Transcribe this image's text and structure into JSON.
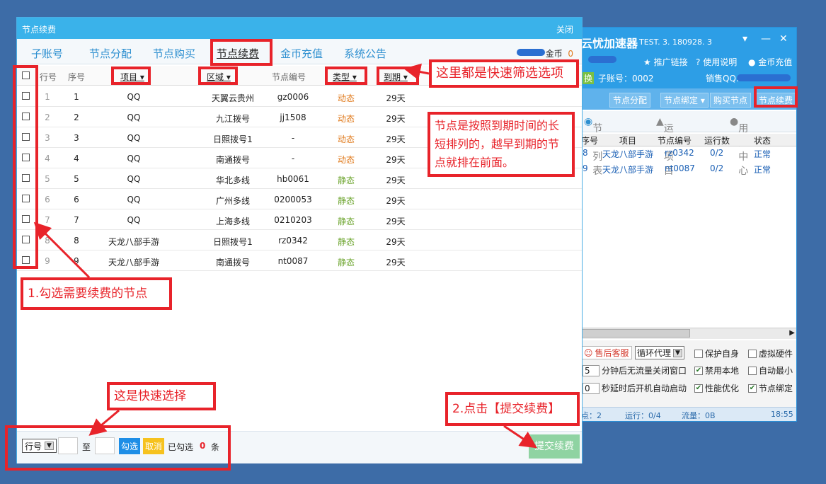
{
  "back_window": {
    "app_title": "云忧加速器",
    "version": "TEST. 3. 180928. 3",
    "promo_link": "推广链接",
    "help_link": "使用说明",
    "coin_recharge_link": "金币充值",
    "switch_label": "换",
    "sub_account_label": "子账号：0002",
    "sales_qq_label": "销售QQ:",
    "nav": [
      "节点分配",
      "节点绑定 ▾",
      "购买节点",
      "节点续费"
    ],
    "tabs": [
      "节点列表",
      "运行项目",
      "用户中心"
    ],
    "headers": [
      "序号",
      "项目",
      "节点编号",
      "运行数",
      "状态"
    ],
    "rows": [
      {
        "no": "8",
        "project": "天龙八部手游",
        "node": "rz0342",
        "runs": "0/2",
        "status": "正常"
      },
      {
        "no": "9",
        "project": "天龙八部手游",
        "node": "nt0087",
        "runs": "0/2",
        "status": "正常"
      }
    ],
    "service_button": "售后客服",
    "proxy_mode": "循环代理",
    "minutes_value": "5",
    "minutes_label": "分钟后无流量关闭窗口",
    "seconds_value": "0",
    "seconds_label": "秒延时后开机自动启动",
    "checks": [
      {
        "label": "保护自身",
        "checked": false
      },
      {
        "label": "虚拟硬件",
        "checked": false
      },
      {
        "label": "禁用本地",
        "checked": true
      },
      {
        "label": "自动最小",
        "checked": false
      },
      {
        "label": "性能优化",
        "checked": true
      },
      {
        "label": "节点绑定",
        "checked": true
      }
    ],
    "footer": {
      "nodes": "点：2",
      "running": "运行：0/4",
      "traffic": "流量：0B",
      "time": "18:55"
    }
  },
  "main": {
    "title": "节点续费",
    "close": "关闭",
    "tabs": [
      "子账号",
      "节点分配",
      "节点购买",
      "节点续费",
      "金币充值",
      "系统公告"
    ],
    "coin_label": "金币",
    "coin_value": "0",
    "headers": {
      "row": "行号",
      "seq": "序号",
      "project": "项目 ▾",
      "region": "区域 ▾",
      "node": "节点编号",
      "type": "类型 ▾",
      "expire": "到期 ▾"
    },
    "rows": [
      {
        "row": "1",
        "seq": "1",
        "project": "QQ",
        "region": "天翼云贵州",
        "node": "gz0006",
        "type": "动态",
        "expire": "29天"
      },
      {
        "row": "2",
        "seq": "2",
        "project": "QQ",
        "region": "九江拨号",
        "node": "jj1508",
        "type": "动态",
        "expire": "29天"
      },
      {
        "row": "3",
        "seq": "3",
        "project": "QQ",
        "region": "日照拨号1",
        "node": "-",
        "type": "动态",
        "expire": "29天"
      },
      {
        "row": "4",
        "seq": "4",
        "project": "QQ",
        "region": "南通拨号",
        "node": "-",
        "type": "动态",
        "expire": "29天"
      },
      {
        "row": "5",
        "seq": "5",
        "project": "QQ",
        "region": "华北多线",
        "node": "hb0061",
        "type": "静态",
        "expire": "29天"
      },
      {
        "row": "6",
        "seq": "6",
        "project": "QQ",
        "region": "广州多线",
        "node": "0200053",
        "type": "静态",
        "expire": "29天"
      },
      {
        "row": "7",
        "seq": "7",
        "project": "QQ",
        "region": "上海多线",
        "node": "0210203",
        "type": "静态",
        "expire": "29天"
      },
      {
        "row": "8",
        "seq": "8",
        "project": "天龙八部手游",
        "region": "日照拨号1",
        "node": "rz0342",
        "type": "静态",
        "expire": "29天"
      },
      {
        "row": "9",
        "seq": "9",
        "project": "天龙八部手游",
        "region": "南通拨号",
        "node": "nt0087",
        "type": "静态",
        "expire": "29天"
      }
    ],
    "bottom": {
      "select_value": "行号",
      "to_label": "至",
      "select_button": "勾选",
      "cancel_button": "取消",
      "selected_label": "已勾选",
      "selected_count": "0",
      "unit": "条",
      "submit_button": "提交续费"
    }
  },
  "callouts": {
    "filter": "这里都是快速筛选选项",
    "sorting": "节点是按照到期时间的长短排列的，越早到期的节点就排在前面。",
    "step1": "1.勾选需要续费的节点",
    "quick": "这是快速选择",
    "step2": "2.点击【提交续费】"
  },
  "colors": {
    "dynamic": "#e07a1c",
    "static": "#6aa32a",
    "accent": "#3ab2ea",
    "annotation": "#e8232a"
  }
}
